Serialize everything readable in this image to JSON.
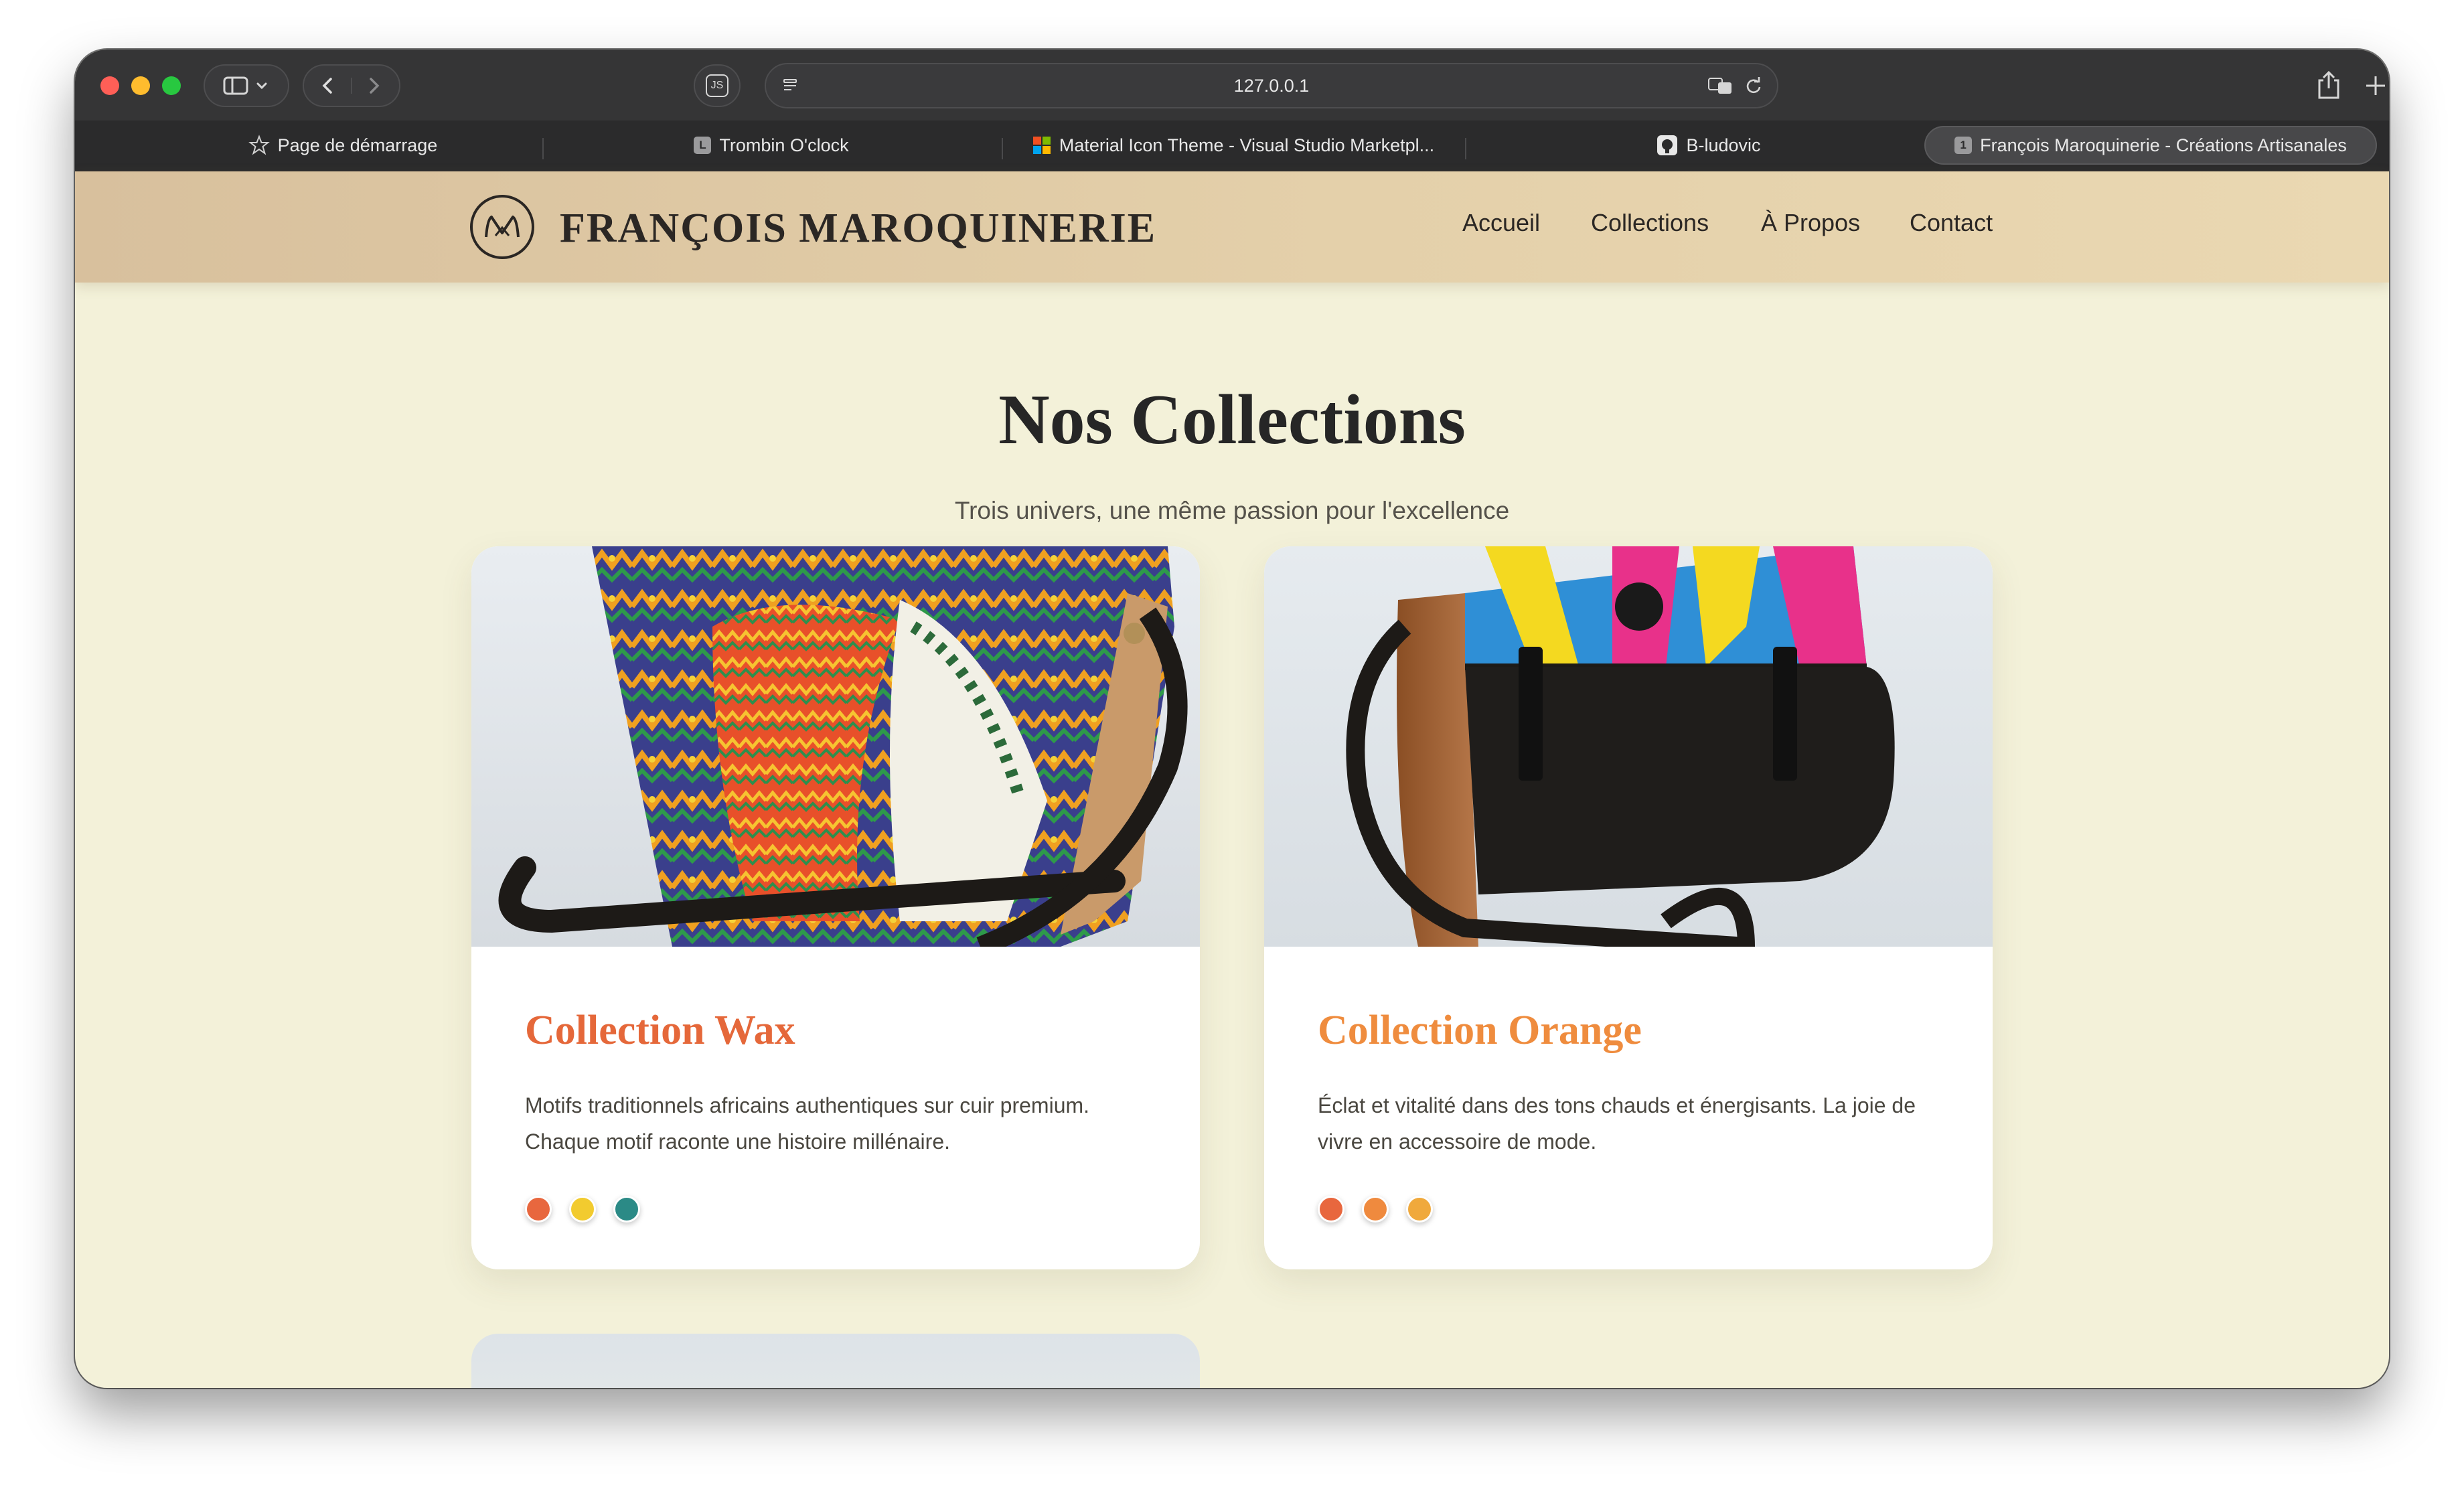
{
  "browser": {
    "url": "127.0.0.1",
    "tabs": [
      {
        "label": "Page de démarrage"
      },
      {
        "label": "Trombin O'clock",
        "favicon": "L"
      },
      {
        "label": "Material Icon Theme - Visual Studio Marketpl..."
      },
      {
        "label": "B-ludovic"
      },
      {
        "label": "François Maroquinerie - Créations Artisanales",
        "favicon": "1"
      }
    ],
    "extension_badge": "JS"
  },
  "site": {
    "brand": "FRANÇOIS MAROQUINERIE",
    "nav": [
      "Accueil",
      "Collections",
      "À Propos",
      "Contact"
    ]
  },
  "main": {
    "title": "Nos Collections",
    "subtitle": "Trois univers, une même passion pour l'excellence",
    "collections": [
      {
        "title": "Collection Wax",
        "description": "Motifs traditionnels africains authentiques sur cuir premium. Chaque motif raconte une histoire millénaire.",
        "title_color": "#e5683a",
        "swatches": [
          "#e8673e",
          "#f2cb2f",
          "#2b8a86"
        ]
      },
      {
        "title": "Collection Orange",
        "description": "Éclat et vitalité dans des tons chauds et énergisants. La joie de vivre en accessoire de mode.",
        "title_color": "#ef8c3e",
        "swatches": [
          "#e8673e",
          "#ef8a3e",
          "#f0a93c"
        ]
      }
    ]
  }
}
